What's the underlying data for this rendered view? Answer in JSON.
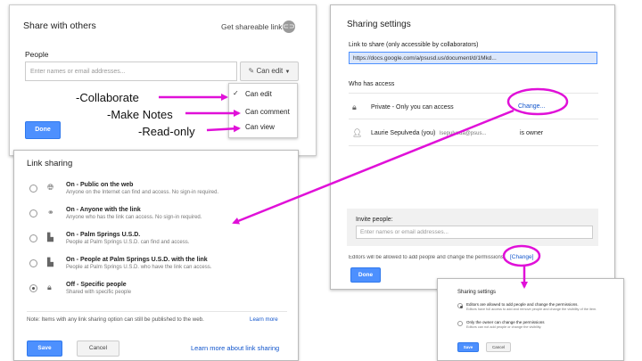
{
  "share": {
    "title": "Share with others",
    "shareable_link": "Get shareable link",
    "people_label": "People",
    "people_placeholder": "Enter names or email addresses...",
    "can_edit_btn": "Can edit",
    "done": "Done",
    "menu": [
      "Can edit",
      "Can comment",
      "Can view"
    ],
    "menu_check": "✓"
  },
  "annotations": [
    "-Collaborate",
    "-Make Notes",
    "-Read-only"
  ],
  "settings": {
    "title": "Sharing settings",
    "link_label": "Link to share (only accessible by collaborators)",
    "link_url": "https://docs.google.com/a/psusd.us/document/d/1Mkd...",
    "who_label": "Who has access",
    "private_text": "Private - Only you can access",
    "change_link": "Change...",
    "owner_name": "Laurie Sepulveda (you)",
    "owner_email": "lsepulveda@psus...",
    "owner_role": "is owner",
    "invite_label": "Invite people:",
    "invite_placeholder": "Enter names or email addresses...",
    "editors_note": "Editors will be allowed to add people and change the permissions.",
    "editors_change": "[Change]",
    "done": "Done"
  },
  "link_sharing": {
    "title": "Link sharing",
    "options": [
      {
        "title": "On - Public on the web",
        "desc": "Anyone on the Internet can find and access. No sign-in required."
      },
      {
        "title": "On - Anyone with the link",
        "desc": "Anyone who has the link can access. No sign-in required."
      },
      {
        "title": "On - Palm Springs U.S.D.",
        "desc": "People at Palm Springs U.S.D. can find and access."
      },
      {
        "title": "On - People at Palm Springs U.S.D. with the link",
        "desc": "People at Palm Springs U.S.D. who have the link can access."
      },
      {
        "title": "Off - Specific people",
        "desc": "Shared with specific people"
      }
    ],
    "note": "Note: Items with any link sharing option can still be published to the web.",
    "learn_more": "Learn more",
    "save": "Save",
    "cancel": "Cancel",
    "learn_more_link": "Learn more about link sharing"
  },
  "mini": {
    "title": "Sharing settings",
    "opt1": "Editors are allowed to add people and change the permissions.",
    "opt1_desc": "Editors have full access to add and remove people and change the visibility of the item.",
    "opt2": "Only the owner can change the permissions",
    "opt2_desc": "Editors can not add people or change the visibility.",
    "save": "Save",
    "cancel": "Cancel"
  },
  "colors": {
    "annotation": "#e010d8",
    "primary": "#4d90fe",
    "link": "#1155cc"
  }
}
